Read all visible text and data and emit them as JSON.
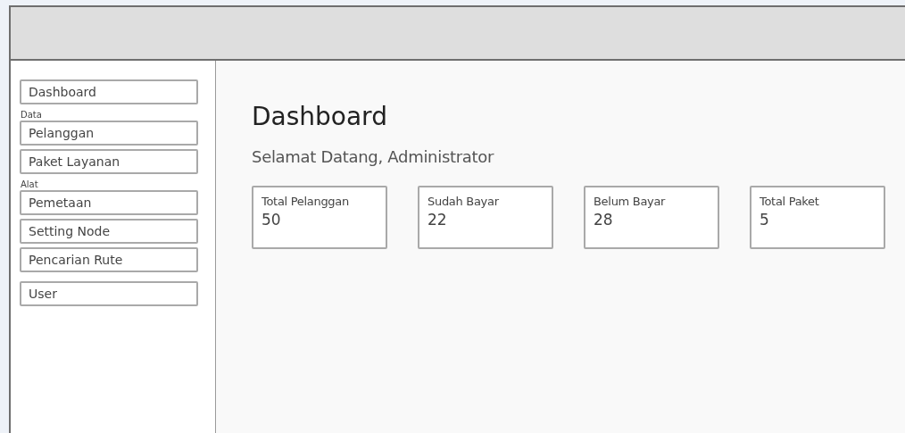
{
  "sidebar": {
    "items": [
      {
        "kind": "link",
        "label": "Dashboard"
      },
      {
        "kind": "section",
        "label": "Data"
      },
      {
        "kind": "link",
        "label": "Pelanggan"
      },
      {
        "kind": "link",
        "label": "Paket Layanan"
      },
      {
        "kind": "section",
        "label": "Alat"
      },
      {
        "kind": "link",
        "label": "Pemetaan"
      },
      {
        "kind": "link",
        "label": "Setting Node"
      },
      {
        "kind": "link",
        "label": "Pencarian Rute"
      },
      {
        "kind": "gap"
      },
      {
        "kind": "link",
        "label": "User"
      }
    ]
  },
  "main": {
    "title": "Dashboard",
    "subtitle": "Selamat Datang, Administrator",
    "cards": [
      {
        "label": "Total Pelanggan",
        "value": "50"
      },
      {
        "label": "Sudah Bayar",
        "value": "22"
      },
      {
        "label": "Belum Bayar",
        "value": "28"
      },
      {
        "label": "Total Paket",
        "value": "5"
      }
    ]
  }
}
